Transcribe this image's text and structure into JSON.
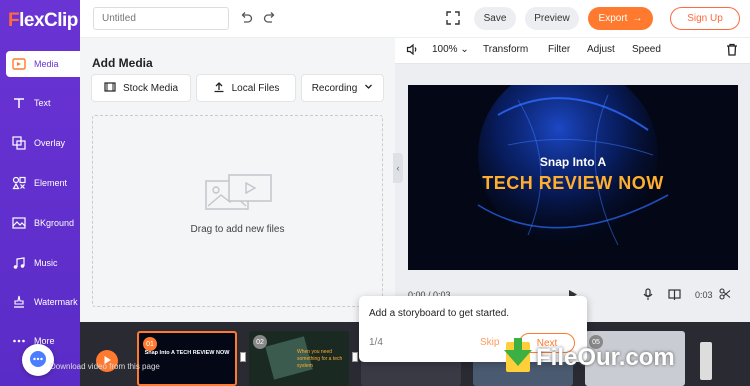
{
  "app": {
    "logo": "FlexClip"
  },
  "sidebar": {
    "items": [
      {
        "label": "Media",
        "icon": "media-icon",
        "active": true
      },
      {
        "label": "Text",
        "icon": "text-icon"
      },
      {
        "label": "Overlay",
        "icon": "overlay-icon"
      },
      {
        "label": "Element",
        "icon": "element-icon"
      },
      {
        "label": "BKground",
        "icon": "background-icon"
      },
      {
        "label": "Music",
        "icon": "music-icon"
      },
      {
        "label": "Watermark",
        "icon": "watermark-icon"
      },
      {
        "label": "More",
        "icon": "more-icon"
      }
    ]
  },
  "header": {
    "title_placeholder": "Untitled",
    "save_label": "Save",
    "preview_label": "Preview",
    "export_label": "Export",
    "signup_label": "Sign Up"
  },
  "media_panel": {
    "title": "Add Media",
    "tabs": [
      "Stock Media",
      "Local Files",
      "Recording"
    ],
    "drop_text": "Drag to add new files"
  },
  "toolbar": {
    "zoom": "100%",
    "items": [
      "Transform",
      "Filter",
      "Adjust",
      "Speed"
    ]
  },
  "preview": {
    "subtitle": "Snap Into A",
    "title": "TECH REVIEW NOW",
    "time": "0:00 / 0:03",
    "duration": "0:03"
  },
  "timeline": {
    "clips": [
      {
        "num": "01",
        "caption": "Snap Into A TECH REVIEW NOW"
      },
      {
        "num": "02",
        "caption": "When you need something for a tech system"
      },
      {
        "num": "03",
        "caption": ""
      },
      {
        "num": "04",
        "caption": ""
      },
      {
        "num": "05",
        "caption": ""
      }
    ]
  },
  "popover": {
    "text": "Add a storyboard to get started.",
    "step": "1/4",
    "skip": "Skip",
    "next": "Next"
  },
  "overlay_text": {
    "download_hint": "Download video from this page",
    "watermark": "FileOur.com"
  },
  "colors": {
    "accent": "#ff7a2e",
    "sidebar": "#6a33d4"
  }
}
